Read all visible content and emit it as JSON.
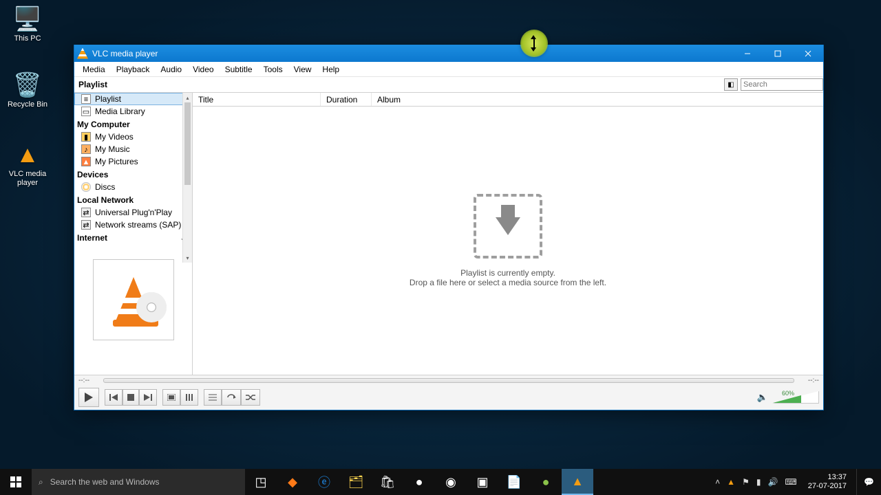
{
  "desktop": {
    "icons": [
      {
        "label": "This PC",
        "glyph": "🖥️"
      },
      {
        "label": "Recycle Bin",
        "glyph": "🗑️"
      },
      {
        "label": "VLC media player",
        "glyph": "▲"
      }
    ]
  },
  "window": {
    "title": "VLC media player",
    "menubar": [
      "Media",
      "Playback",
      "Audio",
      "Video",
      "Subtitle",
      "Tools",
      "View",
      "Help"
    ],
    "toolbar": {
      "playlist_label": "Playlist",
      "search_placeholder": "Search"
    },
    "sidebar": {
      "groups": [
        {
          "label": "",
          "items": [
            {
              "label": "Playlist",
              "selected": true
            },
            {
              "label": "Media Library"
            }
          ]
        },
        {
          "label": "My Computer",
          "items": [
            {
              "label": "My Videos"
            },
            {
              "label": "My Music"
            },
            {
              "label": "My Pictures"
            }
          ]
        },
        {
          "label": "Devices",
          "items": [
            {
              "label": "Discs"
            }
          ]
        },
        {
          "label": "Local Network",
          "items": [
            {
              "label": "Universal Plug'n'Play"
            },
            {
              "label": "Network streams (SAP)"
            }
          ]
        },
        {
          "label": "Internet",
          "items": []
        }
      ]
    },
    "columns": {
      "title": "Title",
      "duration": "Duration",
      "album": "Album"
    },
    "dropzone": {
      "line1": "Playlist is currently empty.",
      "line2": "Drop a file here or select a media source from the left."
    },
    "controls": {
      "time_left": "--:--",
      "time_right": "--:--",
      "volume_percent": "60%"
    }
  },
  "taskbar": {
    "search_placeholder": "Search the web and Windows",
    "clock_time": "13:37",
    "clock_date": "27-07-2017"
  }
}
